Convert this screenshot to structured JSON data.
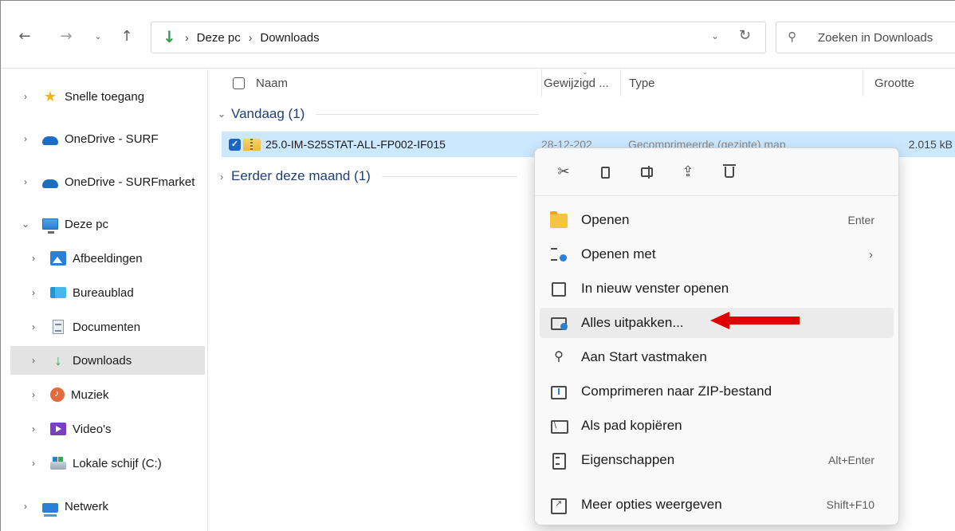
{
  "address_bar": {
    "breadcrumbs": [
      "Deze pc",
      "Downloads"
    ],
    "breadcrumb_sep": "›"
  },
  "search": {
    "placeholder": "Zoeken in Downloads"
  },
  "sidebar": {
    "items": [
      {
        "label": "Snelle toegang",
        "icon": "star-icon"
      },
      {
        "label": "OneDrive - SURF",
        "icon": "cloud-icon"
      },
      {
        "label": "OneDrive - SURFmarket",
        "icon": "cloud-icon"
      },
      {
        "label": "Deze pc",
        "icon": "computer-icon"
      },
      {
        "label": "Afbeeldingen",
        "icon": "pictures-icon"
      },
      {
        "label": "Bureaublad",
        "icon": "desktop-icon"
      },
      {
        "label": "Documenten",
        "icon": "documents-icon"
      },
      {
        "label": "Downloads",
        "icon": "download-icon"
      },
      {
        "label": "Muziek",
        "icon": "music-icon"
      },
      {
        "label": "Video's",
        "icon": "video-icon"
      },
      {
        "label": "Lokale schijf (C:)",
        "icon": "drive-icon"
      },
      {
        "label": "Netwerk",
        "icon": "network-icon"
      }
    ],
    "selected": "Downloads"
  },
  "columns": {
    "name": "Naam",
    "date": "Gewijzigd ...",
    "type": "Type",
    "size": "Grootte"
  },
  "groups": {
    "today": "Vandaag (1)",
    "earlier": "Eerder deze maand (1)"
  },
  "file": {
    "name": "25.0-IM-S25STAT-ALL-FP002-IF015",
    "date": "28-12-202",
    "type": "Gecomprimeerde (gezipte) map",
    "size": "2.015 kB"
  },
  "context_menu": {
    "quick_actions": [
      "cut-icon",
      "copy-icon",
      "rename-icon",
      "share-icon",
      "delete-icon"
    ],
    "items": [
      {
        "label": "Openen",
        "shortcut": "Enter",
        "icon": "folder-icon"
      },
      {
        "label": "Openen met",
        "shortcut": "",
        "submenu": "›",
        "icon": "open-with-icon"
      },
      {
        "label": "In nieuw venster openen",
        "shortcut": "",
        "icon": "new-window-icon"
      },
      {
        "label": "Alles uitpakken...",
        "shortcut": "",
        "icon": "extract-icon",
        "highlighted": true
      },
      {
        "label": "Aan Start vastmaken",
        "shortcut": "",
        "icon": "pin-icon"
      },
      {
        "label": "Comprimeren naar ZIP-bestand",
        "shortcut": "",
        "icon": "zip-icon"
      },
      {
        "label": "Als pad kopiëren",
        "shortcut": "",
        "icon": "copy-path-icon"
      },
      {
        "label": "Eigenschappen",
        "shortcut": "Alt+Enter",
        "icon": "properties-icon"
      },
      {
        "label": "Meer opties weergeven",
        "shortcut": "Shift+F10",
        "icon": "more-options-icon"
      }
    ]
  },
  "colors": {
    "accent": "#1a66c2",
    "selection": "#cce8ff",
    "annotation_arrow": "#e00000",
    "group_header": "#1f3f7a"
  }
}
